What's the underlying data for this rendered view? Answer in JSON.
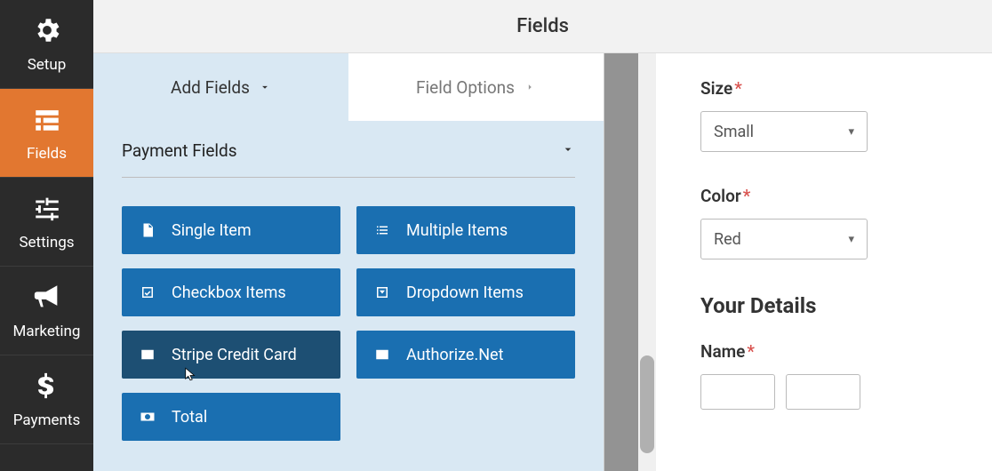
{
  "sidebar": {
    "items": [
      {
        "label": "Setup"
      },
      {
        "label": "Fields"
      },
      {
        "label": "Settings"
      },
      {
        "label": "Marketing"
      },
      {
        "label": "Payments"
      }
    ]
  },
  "header": {
    "title": "Fields"
  },
  "tabs": {
    "add_fields": "Add Fields",
    "field_options": "Field Options"
  },
  "section": {
    "title": "Payment Fields",
    "items": [
      {
        "label": "Single Item"
      },
      {
        "label": "Multiple Items"
      },
      {
        "label": "Checkbox Items"
      },
      {
        "label": "Dropdown Items"
      },
      {
        "label": "Stripe Credit Card"
      },
      {
        "label": "Authorize.Net"
      },
      {
        "label": "Total"
      }
    ]
  },
  "preview": {
    "size": {
      "label": "Size",
      "value": "Small"
    },
    "color": {
      "label": "Color",
      "value": "Red"
    },
    "details_heading": "Your Details",
    "name": {
      "label": "Name"
    }
  }
}
